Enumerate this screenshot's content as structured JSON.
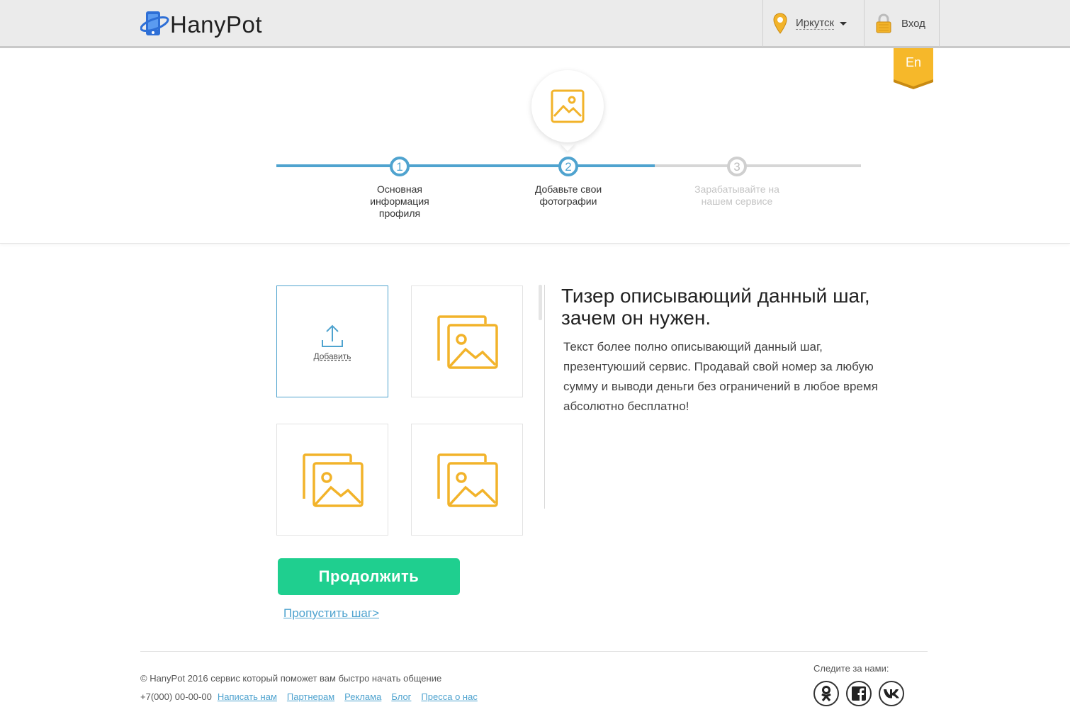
{
  "header": {
    "brand": "HanyPot",
    "city": "Иркутск",
    "login": "Вход",
    "lang": "En"
  },
  "steps": [
    {
      "number": "1",
      "label": "Основная информация профиля",
      "state": "done"
    },
    {
      "number": "2",
      "label": "Добавьте свои фотографии",
      "state": "active"
    },
    {
      "number": "3",
      "label": "Зарабатывайте на нашем сервисе",
      "state": "todo"
    }
  ],
  "photos": {
    "upload_label": "Добавить"
  },
  "teaser": {
    "title": "Тизер описывающий данный шаг, зачем он нужен.",
    "text": "Текст более полно описывающий данный шаг, презентуюший сервис. Продавай свой номер за любую сумму и выводи деньги без ограничений в любое время абсолютно бесплатно!"
  },
  "actions": {
    "continue": "Продолжить",
    "skip": "Пропустить шаг>"
  },
  "footer": {
    "copyright": "© HanyPot 2016 сервис который поможет вам быстро начать общение",
    "phone": "+7(000) 00-00-00",
    "links": [
      "Написать нам",
      "Партнерам",
      "Реклама",
      "Блог",
      "Пресса о нас"
    ],
    "follow": "Следите за нами:"
  },
  "colors": {
    "accent": "#4fa3cf",
    "button": "#1fcf8f",
    "icon": "#f2b32a"
  }
}
